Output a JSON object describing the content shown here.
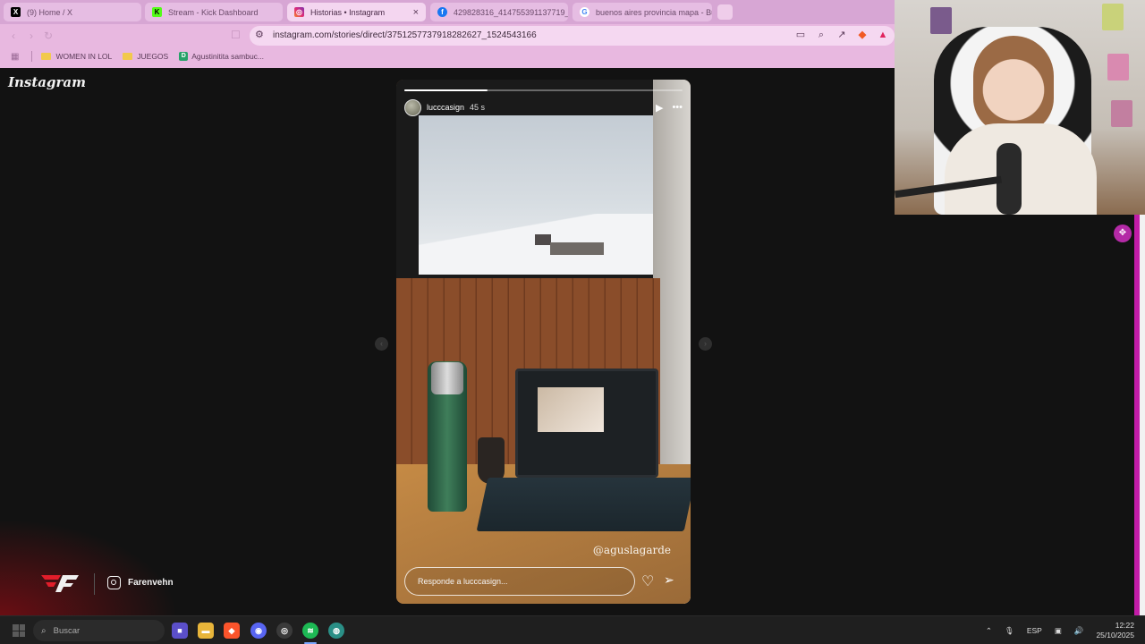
{
  "browser": {
    "tabs": [
      {
        "label": "(9) Home / X",
        "icon": "x-logo-icon",
        "color": "#000000"
      },
      {
        "label": "Stream - Kick Dashboard",
        "icon": "kick-logo-icon",
        "color": "#53fc18"
      },
      {
        "label": "Historias • Instagram",
        "icon": "instagram-logo-icon",
        "color": "#e1306c"
      },
      {
        "label": "429828316_414755391137719_12...",
        "icon": "facebook-logo-icon",
        "color": "#1877f2"
      },
      {
        "label": "buenos aires provincia mapa - Bu...",
        "icon": "google-logo-icon",
        "color": "#4285f4"
      }
    ],
    "url": "instagram.com/stories/direct/3751257737918282627_1524543166",
    "bookmarks": [
      {
        "label": "WOMEN IN LOL",
        "type": "folder"
      },
      {
        "label": "JUEGOS",
        "type": "folder"
      },
      {
        "label": "Agustinitita sambuc...",
        "type": "site"
      }
    ]
  },
  "instagram": {
    "logo": "Instagram",
    "story": {
      "username": "lucccasign",
      "time": "45 s",
      "progress_fraction": 0.3,
      "tag": "@aguslagarde",
      "reply_placeholder": "Responde a lucccasign..."
    }
  },
  "overlay": {
    "instagram_handle": "Farenvehn"
  },
  "taskbar": {
    "search_placeholder": "Buscar",
    "language": "ESP",
    "time": "12:22",
    "date": "25/10/2025"
  }
}
